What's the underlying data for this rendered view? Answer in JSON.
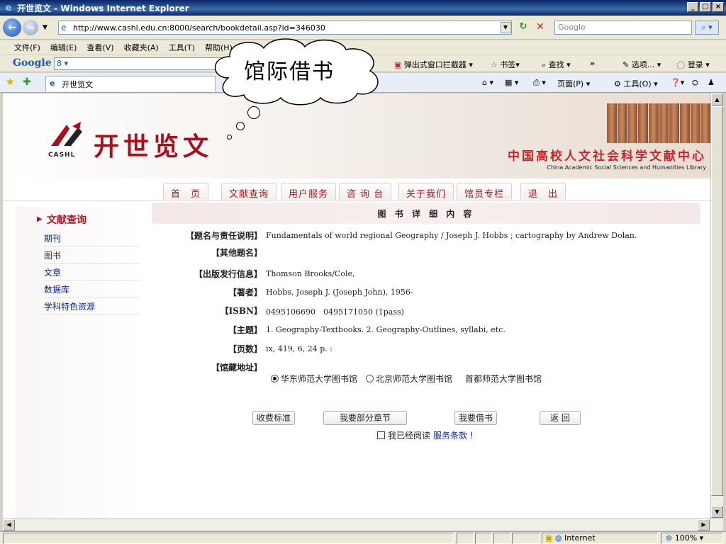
{
  "window": {
    "title": "开世览文 - Windows Internet Explorer",
    "controls": [
      "_",
      "□",
      "×"
    ]
  },
  "address_bar": {
    "url": "http://www.cashl.edu.cn:8000/search/bookdetail.asp?id=346030",
    "search_placeholder": "Google"
  },
  "menu": [
    "文件(F)",
    "编辑(E)",
    "查看(V)",
    "收藏夹(A)",
    "工具(T)",
    "帮助(H)"
  ],
  "google_toolbar": {
    "logo": "Google",
    "search_value": "8 ▾",
    "popup_blocker": "弹出式窗口拦截器",
    "bookmarks": "书签",
    "find": "查找",
    "more": "»",
    "options": "选项...",
    "login": "登录"
  },
  "tab": {
    "title": "开世览文",
    "page_menu": "页面(P)",
    "tools_menu": "工具(O)"
  },
  "callout": {
    "text": "馆际借书"
  },
  "site": {
    "logo_text": "开世览文",
    "logo_sub": "CASHL",
    "org_cn": "中国高校人文社会科学文献中心",
    "org_en": "China Academic Social Sciences and Humanities Library"
  },
  "nav_tabs": [
    "首　页",
    "文献查询",
    "用户服务",
    "咨 询 台",
    "关于我们",
    "馆员专栏",
    "退　出"
  ],
  "sidebar": {
    "title": "文献查询",
    "items": [
      "期刊",
      "图书",
      "文章",
      "数据库",
      "学科特色资源"
    ]
  },
  "detail": {
    "header": "图 书 详 细 内 容",
    "rows": [
      {
        "label": "【题名与责任说明】",
        "value": "Fundamentals of world regional Geography / Joseph J. Hobbs ; cartography by Andrew Dolan."
      },
      {
        "label": "【其他题名】",
        "value": ""
      },
      {
        "label": "【出版发行信息】",
        "value": "Thomson Brooks/Cole,"
      },
      {
        "label": "【著者】",
        "value": "Hobbs, Joseph J. (Joseph John), 1956-"
      },
      {
        "label": "【ISBN】",
        "value": "0495106690　0495171050 (1pass)"
      },
      {
        "label": "【主题】",
        "value": "1. Geography-Textbooks. 2. Geography-Outlines, syllabi, etc."
      },
      {
        "label": "【页数】",
        "value": "ix, 419, 6, 24 p. :"
      },
      {
        "label": "【馆藏地址】",
        "value": ""
      }
    ],
    "libraries": [
      "华东师范大学图书馆",
      "北京师范大学图书馆",
      "首都师范大学图书馆"
    ],
    "buttons": {
      "fee": "收费标准",
      "partial": "我要部分章节",
      "borrow": "我要借书",
      "back": "返 回"
    },
    "agree_prefix": "我已经阅读",
    "agree_link": "服务条款",
    "agree_suffix": "!"
  },
  "status": {
    "zone": "Internet",
    "zoom": "100%"
  }
}
